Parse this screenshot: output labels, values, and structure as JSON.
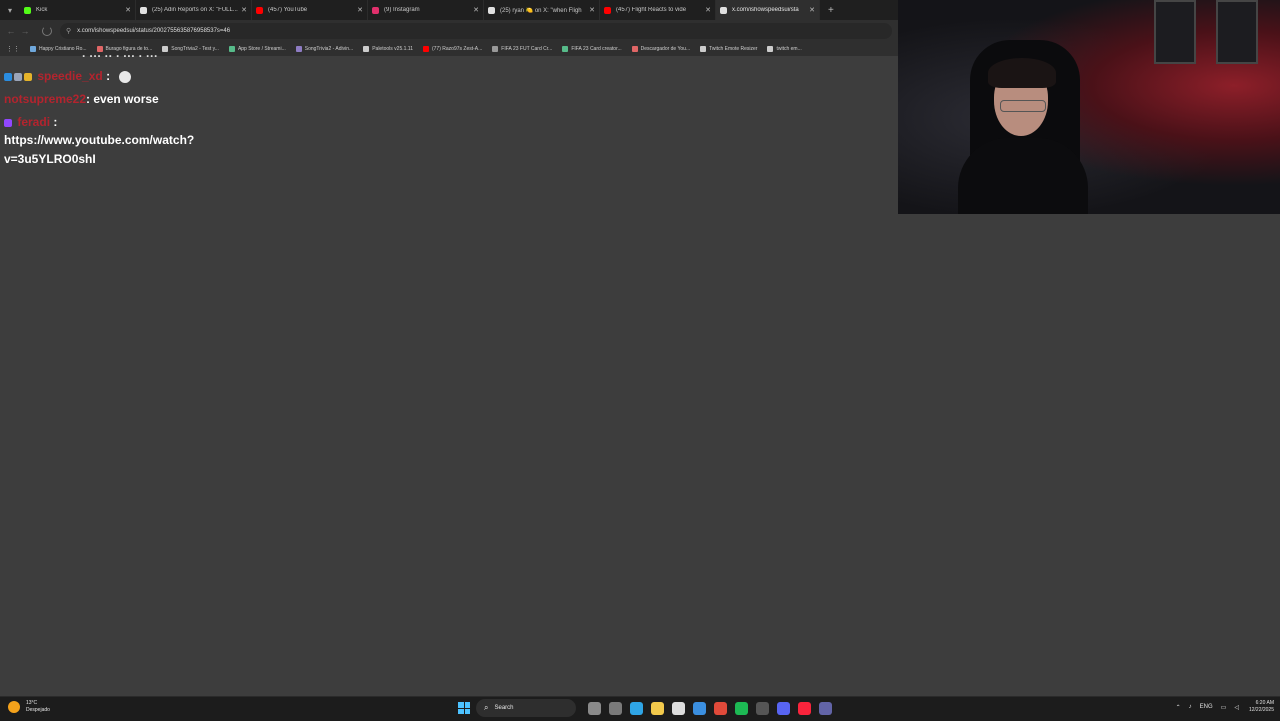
{
  "tabs": [
    {
      "label": "Kick",
      "color": "#53fc18"
    },
    {
      "label": "(25) Adin Reports on X: \"FULL...",
      "color": "#e0e0e0"
    },
    {
      "label": "(457) YouTube",
      "color": "#ff0000"
    },
    {
      "label": "(9) Instagram",
      "color": "#e1306c"
    },
    {
      "label": "(25) ryan 🍋 on X: \"when Fligh",
      "color": "#e0e0e0"
    },
    {
      "label": "(457) Flight Reacts to vide",
      "color": "#ff0000"
    },
    {
      "label": "x.com/ishowspeedsui/sta",
      "color": "#e0e0e0",
      "active": true
    }
  ],
  "address": {
    "url": "x.com/ishowspeedsui/status/2002755635876958537s=46"
  },
  "bookmarks": [
    {
      "label": "Happy Cristiano Ro...",
      "color": "#6fa8dc"
    },
    {
      "label": "Burago figura de to...",
      "color": "#e06666"
    },
    {
      "label": "SongTrivia2 - Test y...",
      "color": "#cccccc"
    },
    {
      "label": "App Store / Streami...",
      "color": "#57bb8a"
    },
    {
      "label": "SongTrivia2 - Adivin...",
      "color": "#8e7cc3"
    },
    {
      "label": "Paletools v25.1.11",
      "color": "#cccccc"
    },
    {
      "label": "(77) Razo97s Zest-A...",
      "color": "#ff0000"
    },
    {
      "label": "FIFA 23 FUT Card Cr...",
      "color": "#999999"
    },
    {
      "label": "FIFA 23 Card creator...",
      "color": "#57bb8a"
    },
    {
      "label": "Descargador de You...",
      "color": "#e06666"
    },
    {
      "label": "Twitch Emote Resizer",
      "color": "#cccccc"
    },
    {
      "label": "twitch em...",
      "color": "#cccccc"
    }
  ],
  "chat": {
    "cut_line": "· ··· ·· · ··· · ···",
    "messages": [
      {
        "username": "speedie_xd",
        "text": ":"
      },
      {
        "username": "notsupreme22",
        "text": ": even worse"
      },
      {
        "username": "feradi",
        "text": ":"
      }
    ],
    "link_line1": "https://www.youtube.com/watch?",
    "link_line2": "v=3u5YLRO0shI"
  },
  "taskbar": {
    "weather_temp": "13°C",
    "weather_desc": "Despejado",
    "search_placeholder": "Search",
    "lang": "ENG",
    "time": "6:20 AM",
    "date": "12/22/2025"
  },
  "taskbar_apps": [
    {
      "name": "file-explorer-icon",
      "color": "#8a8a8a"
    },
    {
      "name": "task-view-icon",
      "color": "#7a7a7a"
    },
    {
      "name": "edge-icon",
      "color": "#2fa5e6"
    },
    {
      "name": "folder-icon",
      "color": "#f2c94c"
    },
    {
      "name": "store-icon",
      "color": "#dddddd"
    },
    {
      "name": "mail-icon",
      "color": "#3b8fe0"
    },
    {
      "name": "chrome-icon",
      "color": "#e04a3a"
    },
    {
      "name": "spotify-icon",
      "color": "#1db954"
    },
    {
      "name": "obs-icon",
      "color": "#555555"
    },
    {
      "name": "discord-icon",
      "color": "#5865f2"
    },
    {
      "name": "music-icon",
      "color": "#fa243c"
    },
    {
      "name": "teams-icon",
      "color": "#6264a7"
    }
  ]
}
